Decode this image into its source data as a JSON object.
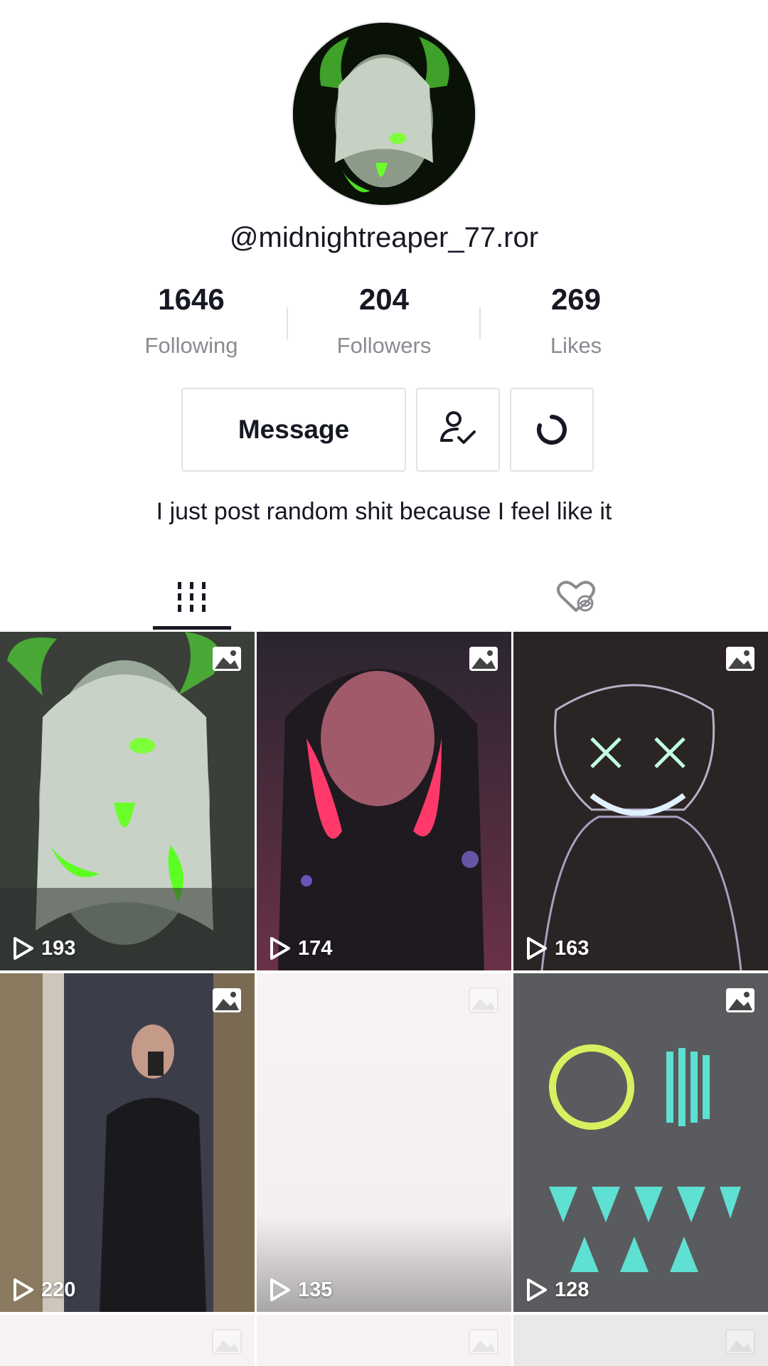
{
  "profile": {
    "username": "@midnightreaper_77.ror",
    "bio": "I just post random shit because I feel like it"
  },
  "stats": [
    {
      "value": "1646",
      "label": "Following"
    },
    {
      "value": "204",
      "label": "Followers"
    },
    {
      "value": "269",
      "label": "Likes"
    }
  ],
  "actions": {
    "message_label": "Message",
    "follow_icon": "user-check-icon",
    "refresh_icon": "refresh-circle-icon"
  },
  "tabs": [
    {
      "icon": "grid-videos-icon",
      "selected": true
    },
    {
      "icon": "liked-hidden-icon",
      "selected": false
    }
  ],
  "videos": [
    {
      "views": "193",
      "type": "photo"
    },
    {
      "views": "174",
      "type": "photo"
    },
    {
      "views": "163",
      "type": "photo"
    },
    {
      "views": "220",
      "type": "photo"
    },
    {
      "views": "135",
      "type": "photo"
    },
    {
      "views": "128",
      "type": "photo"
    }
  ],
  "colors": {
    "text": "#161823",
    "muted": "#8a8b91",
    "border": "#e3e3e4",
    "neon_green": "#6bff2a"
  }
}
